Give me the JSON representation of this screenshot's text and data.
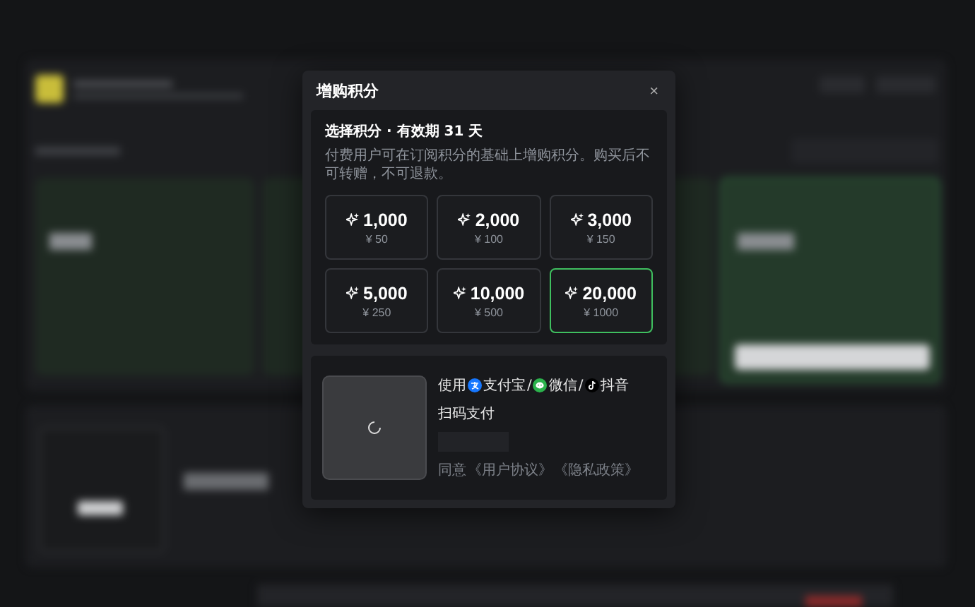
{
  "dialog": {
    "title": "增购积分",
    "close": "×"
  },
  "selection": {
    "heading": "选择积分 · 有效期 31 天",
    "description": "付费用户可在订阅积分的基础上增购积分。购买后不可转赠，不可退款。",
    "packages": [
      {
        "points": "1,000",
        "price": "¥ 50",
        "selected": false
      },
      {
        "points": "2,000",
        "price": "¥ 100",
        "selected": false
      },
      {
        "points": "3,000",
        "price": "¥ 150",
        "selected": false
      },
      {
        "points": "5,000",
        "price": "¥ 250",
        "selected": false
      },
      {
        "points": "10,000",
        "price": "¥ 500",
        "selected": false
      },
      {
        "points": "20,000",
        "price": "¥ 1000",
        "selected": true
      }
    ]
  },
  "payment": {
    "prefix": "使用",
    "separator": "/",
    "methods": [
      {
        "kind": "alipay",
        "label": "支付宝"
      },
      {
        "kind": "wechat",
        "label": "微信"
      },
      {
        "kind": "douyin",
        "label": "抖音"
      }
    ],
    "scan_label": "扫码支付",
    "agree": "同意",
    "links": [
      "《用户协议》",
      "《隐私政策》"
    ]
  }
}
